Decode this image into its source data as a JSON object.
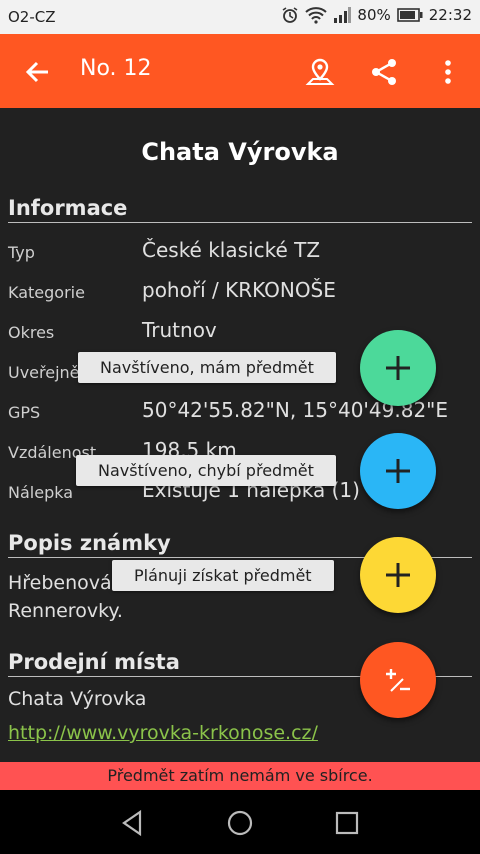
{
  "status": {
    "carrier": "O2-CZ",
    "battery": "80%",
    "time": "22:32"
  },
  "toolbar": {
    "title": "No. 12",
    "back_icon": "arrow-back-icon",
    "map_icon": "map-marker-icon",
    "share_icon": "share-icon",
    "more_icon": "more-vert-icon"
  },
  "page": {
    "title": "Chata Výrovka"
  },
  "info": {
    "heading": "Informace",
    "rows": [
      {
        "label": "Typ",
        "value": "České klasické TZ"
      },
      {
        "label": "Kategorie",
        "value": "pohoří / KRKONOŠE"
      },
      {
        "label": "Okres",
        "value": "Trutnov"
      },
      {
        "label": "Uveřejněno",
        "value": ""
      },
      {
        "label": "GPS",
        "value": "50°42'55.82\"N, 15°40'49.82\"E"
      },
      {
        "label": "Vzdálenost",
        "value": "198,5 km"
      },
      {
        "label": "Nálepka",
        "value": "Existuje 1 nálepka (1)"
      }
    ]
  },
  "description": {
    "heading": "Popis známky",
    "text_line1": "Hřebenová bouda na cestě Luční",
    "text_line2": "Rennerovky."
  },
  "sales": {
    "heading": "Prodejní místa",
    "place": "Chata Výrovka",
    "url": "http://www.vyrovka-krkonose.cz/"
  },
  "fabs": [
    {
      "label": "Navštíveno, mám předmět",
      "color": "#4cd99a"
    },
    {
      "label": "Navštíveno, chybí předmět",
      "color": "#2ab6f6"
    },
    {
      "label": "Plánuji získat předmět",
      "color": "#fdd835"
    }
  ],
  "main_fab": {
    "color": "#ff5722",
    "icon": "plus-minus-icon"
  },
  "snackbar": {
    "text": "Předmět zatím nemám ve sbírce."
  },
  "colors": {
    "accent": "#ff5722",
    "background": "#212121",
    "link": "#8bc34a",
    "snackbar": "#ff5252"
  }
}
